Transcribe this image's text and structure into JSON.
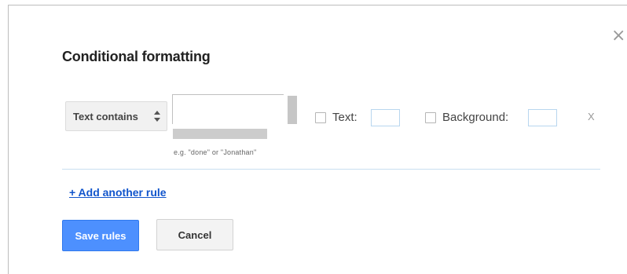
{
  "dialog": {
    "title": "Conditional formatting",
    "close_label": "×"
  },
  "rule": {
    "condition": "Text contains",
    "value": "",
    "placeholder": "",
    "hint": "e.g. \"done\" or \"Jonathan\"",
    "text_color_label": "Text:",
    "text_color_checked": false,
    "background_label": "Background:",
    "background_checked": false,
    "remove_label": "X"
  },
  "actions": {
    "add_rule_label": "+ Add another rule",
    "save_label": "Save rules",
    "cancel_label": "Cancel"
  },
  "icons": {
    "close": "close-icon",
    "select_arrows": "up-down-arrows-icon"
  },
  "colors": {
    "primary_button": "#4d90fe",
    "link": "#1155cc",
    "divider": "#c9dff0"
  }
}
